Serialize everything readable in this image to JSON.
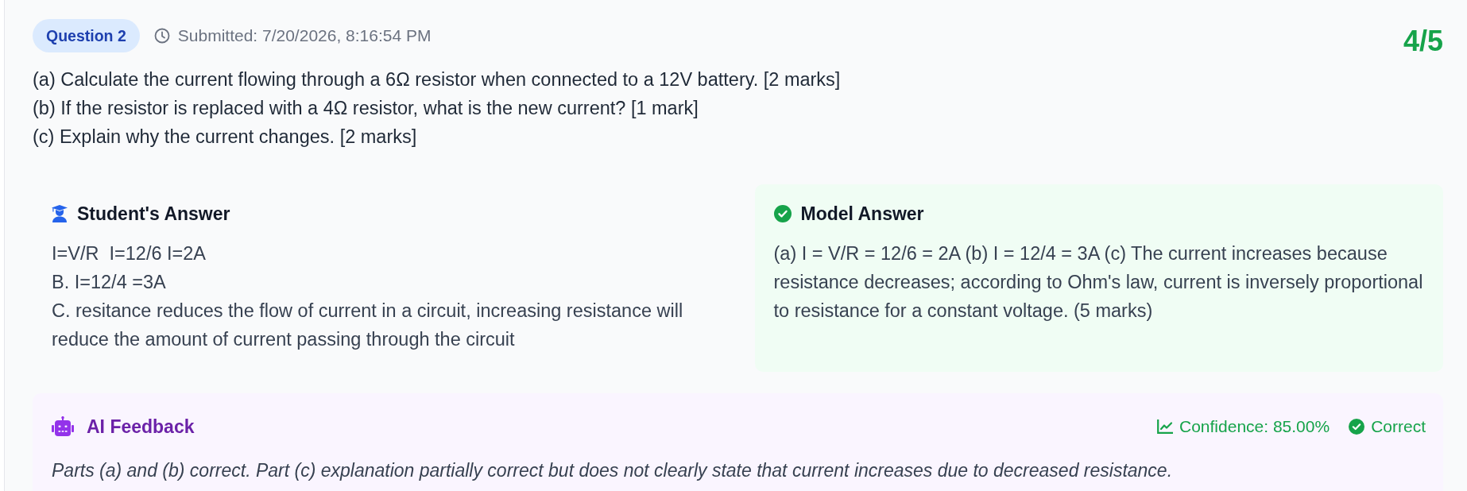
{
  "question": {
    "label": "Question 2",
    "submitted": "Submitted: 7/20/2026, 8:16:54 PM",
    "score": "4/5",
    "parts": [
      "(a) Calculate the current flowing through a 6Ω resistor when connected to a 12V battery. [2 marks]",
      "(b) If the resistor is replaced with a 4Ω resistor, what is the new current? [1 mark]",
      "(c) Explain why the current changes. [2 marks]"
    ]
  },
  "answers": [
    {
      "kind": "student",
      "title": "Student's Answer",
      "lines": [
        "I=V/R  I=12/6 I=2A",
        "B. I=12/4 =3A",
        "C. resitance reduces the flow of current in a circuit, increasing resistance will reduce the amount of current passing through the circuit"
      ]
    },
    {
      "kind": "model",
      "title": "Model Answer",
      "lines": [
        "(a) I = V/R = 12/6 = 2A (b) I = 12/4 = 3A (c) The current increases because resistance decreases; according to Ohm's law, current is inversely proportional to resistance for a constant voltage. (5 marks)"
      ]
    }
  ],
  "feedback": {
    "title": "AI Feedback",
    "confidence": "Confidence: 85.00%",
    "verdict": "Correct",
    "correct": true,
    "text": "Parts (a) and (b) correct. Part (c) explanation partially correct but does not clearly state that current increases due to decreased resistance."
  }
}
